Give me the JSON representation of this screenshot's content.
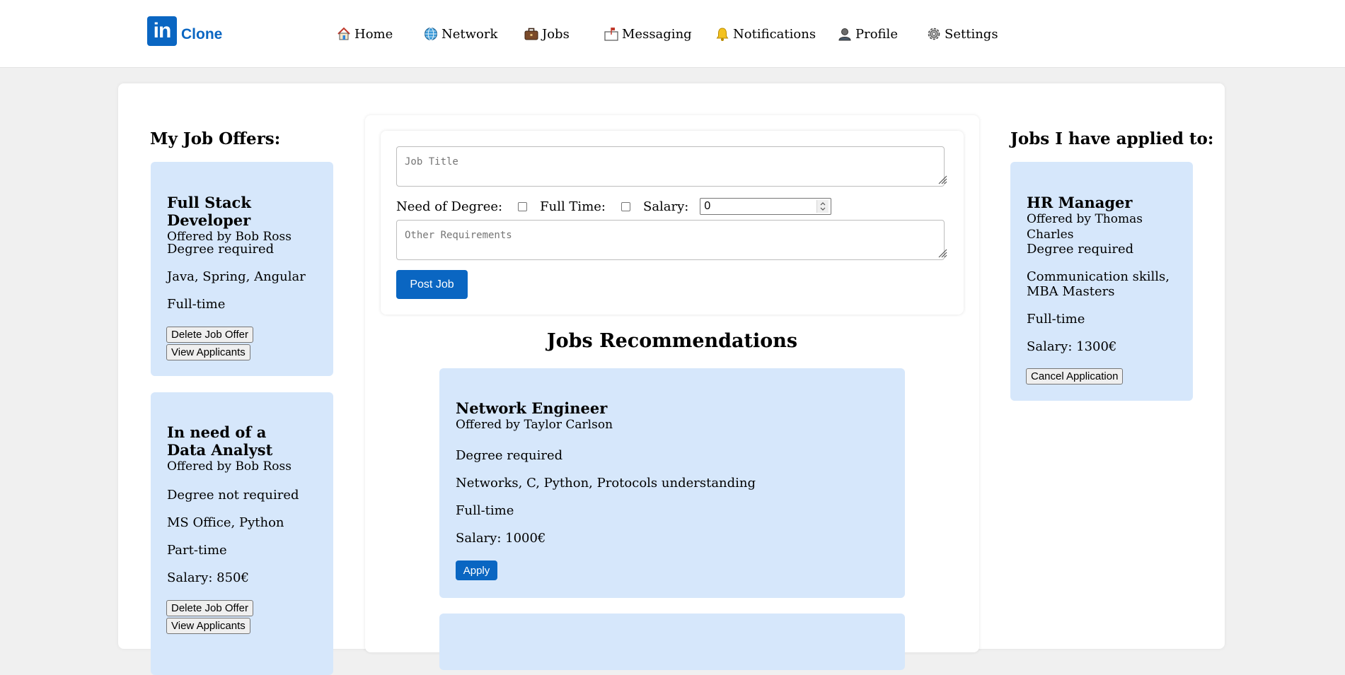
{
  "brand": {
    "logo_letters": "in",
    "name": "Clone",
    "color": "#0a66c2"
  },
  "nav": [
    {
      "label": "Home",
      "icon": "home-icon"
    },
    {
      "label": "Network",
      "icon": "globe-icon"
    },
    {
      "label": "Jobs",
      "icon": "briefcase-icon"
    },
    {
      "label": "Messaging",
      "icon": "mailbox-icon"
    },
    {
      "label": "Notifications",
      "icon": "bell-icon"
    },
    {
      "label": "Profile",
      "icon": "person-icon"
    },
    {
      "label": "Settings",
      "icon": "gear-icon"
    }
  ],
  "my_offers": {
    "title": "My Job Offers:",
    "delete_label": "Delete Job Offer",
    "view_label": "View Applicants",
    "items": [
      {
        "title": "Full Stack Developer",
        "by": "Offered by Bob Ross",
        "degree": "Degree required",
        "skills": "Java, Spring, Angular",
        "type": "Full-time"
      },
      {
        "title": "In need of a Data Analyst",
        "by": "Offered by Bob Ross",
        "degree": "Degree not required",
        "skills": "MS Office, Python",
        "type": "Part-time",
        "salary": "Salary: 850€"
      }
    ]
  },
  "form": {
    "job_title_placeholder": "Job Title",
    "degree_label": "Need of Degree:",
    "fulltime_label": "Full Time:",
    "salary_label": "Salary:",
    "salary_value": "0",
    "other_placeholder": "Other Requirements",
    "post_label": "Post Job"
  },
  "recommendations": {
    "title": "Jobs Recommendations",
    "apply_label": "Apply",
    "items": [
      {
        "title": "Network Engineer",
        "by": "Offered by Taylor Carlson",
        "degree": "Degree required",
        "skills": "Networks, C, Python, Protocols understanding",
        "type": "Full-time",
        "salary": "Salary: 1000€"
      }
    ]
  },
  "applied": {
    "title": "Jobs I have applied to:",
    "cancel_label": "Cancel Application",
    "items": [
      {
        "title": "HR Manager",
        "by": "Offered by Thomas Charles",
        "degree": "Degree required",
        "skills": "Communication skills, MBA Masters",
        "type": "Full-time",
        "salary": "Salary: 1300€"
      }
    ]
  }
}
